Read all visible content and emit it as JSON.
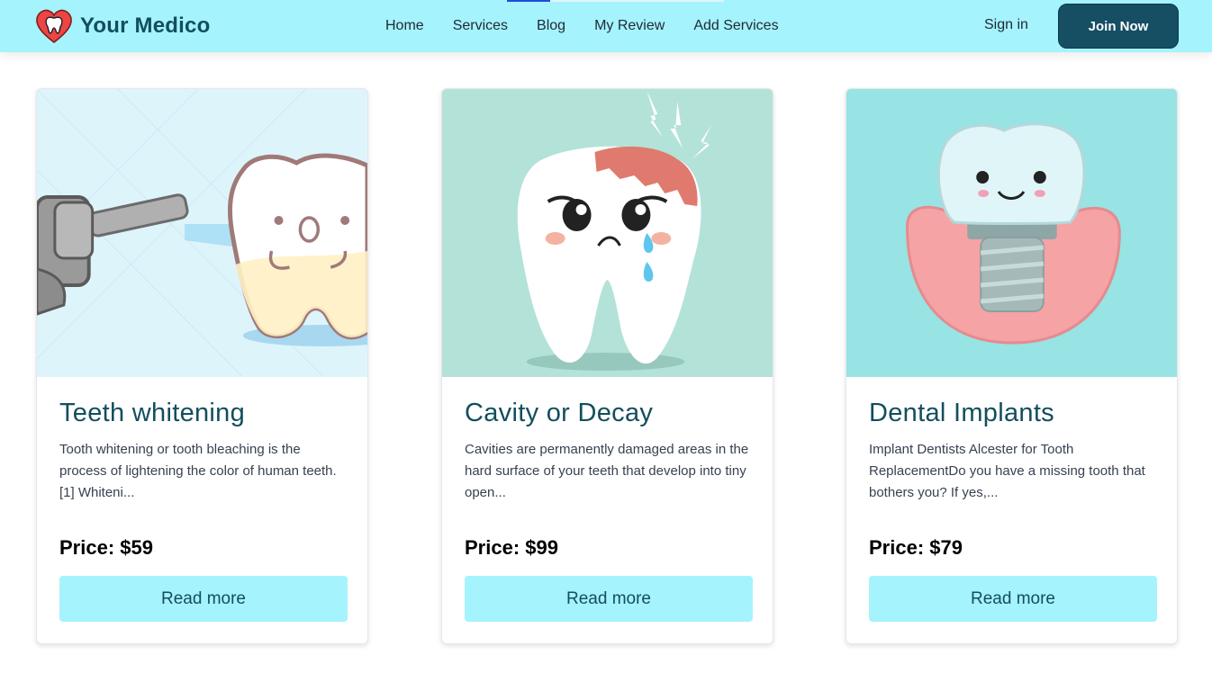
{
  "brand": {
    "name": "Your Medico",
    "logo_icon": "heart-tooth-icon"
  },
  "nav": {
    "links": [
      "Home",
      "Services",
      "Blog",
      "My Review",
      "Add Services"
    ],
    "sign_in": "Sign in",
    "join_now": "Join Now"
  },
  "colors": {
    "navbar_bg": "#a5f3fc",
    "accent_dark": "#164e63",
    "title_color": "#134e5e",
    "button_bg": "#a5f3fc"
  },
  "services": [
    {
      "title": "Teeth whitening",
      "description": "Tooth whitening or tooth bleaching is the process of lightening the color of human teeth.[1] Whiteni...",
      "price_label": "Price: $59",
      "button": "Read more",
      "image_icon": "tooth-whitening-illustration"
    },
    {
      "title": "Cavity or Decay",
      "description": "Cavities are permanently damaged areas in the hard surface of your teeth that develop into tiny open...",
      "price_label": "Price: $99",
      "button": "Read more",
      "image_icon": "sad-tooth-cavity-illustration"
    },
    {
      "title": "Dental Implants",
      "description": "Implant Dentists Alcester for Tooth ReplacementDo you have a missing tooth that bothers you? If yes,...",
      "price_label": "Price: $79",
      "button": "Read more",
      "image_icon": "dental-implant-illustration"
    }
  ]
}
